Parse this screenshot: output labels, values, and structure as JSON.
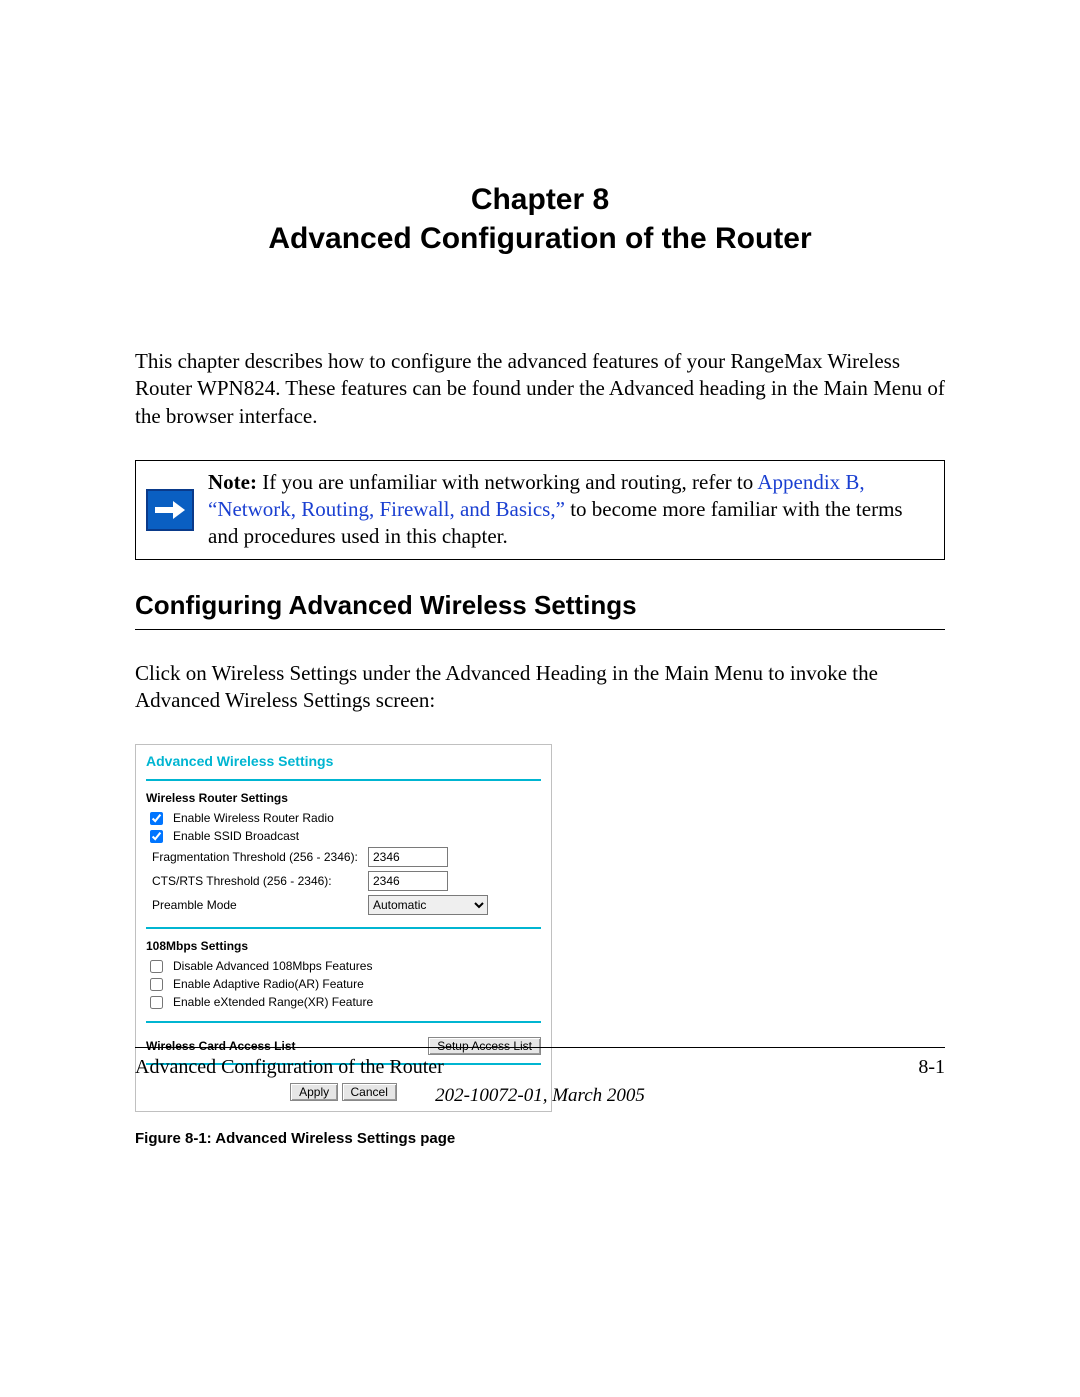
{
  "chapter": {
    "label": "Chapter 8",
    "title": "Advanced Configuration of the Router"
  },
  "intro": "This chapter describes how to configure the advanced features of your RangeMax Wireless Router WPN824. These features can be found under the Advanced heading in the Main Menu of the browser interface.",
  "note": {
    "prefix": "Note: ",
    "before_link": "If you are unfamiliar with networking and routing, refer to ",
    "link": "Appendix B, “Network, Routing, Firewall, and Basics,”",
    "after_link": " to become more familiar with the terms and procedures used in this chapter."
  },
  "section_title": "Configuring Advanced Wireless Settings",
  "section_text": "Click on Wireless Settings under the Advanced Heading in the Main Menu to invoke the Advanced Wireless Settings screen:",
  "screenshot": {
    "title": "Advanced Wireless Settings",
    "group1": "Wireless Router Settings",
    "enable_radio": {
      "label": "Enable Wireless Router Radio",
      "checked": true
    },
    "enable_ssid": {
      "label": "Enable SSID Broadcast",
      "checked": true
    },
    "frag": {
      "label": "Fragmentation Threshold (256 - 2346):",
      "value": "2346"
    },
    "cts": {
      "label": "CTS/RTS Threshold (256 - 2346):",
      "value": "2346"
    },
    "preamble": {
      "label": "Preamble Mode",
      "value": "Automatic"
    },
    "group2": "108Mbps Settings",
    "disable_108": {
      "label": "Disable Advanced 108Mbps Features",
      "checked": false
    },
    "adaptive_radio": {
      "label": "Enable Adaptive Radio(AR) Feature",
      "checked": false
    },
    "xr": {
      "label": "Enable eXtended Range(XR) Feature",
      "checked": false
    },
    "access_heading": "Wireless Card Access List",
    "setup_access_btn": "Setup Access List",
    "apply_btn": "Apply",
    "cancel_btn": "Cancel"
  },
  "figure_caption": "Figure 8-1:  Advanced Wireless Settings page",
  "footer": {
    "left": "Advanced Configuration of the Router",
    "right": "8-1",
    "doc": "202-10072-01, March 2005"
  }
}
